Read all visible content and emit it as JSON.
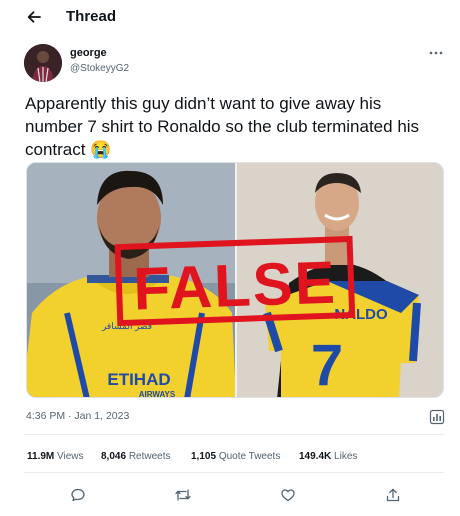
{
  "header": {
    "title": "Thread"
  },
  "author": {
    "name": "george",
    "handle": "@StokeyyG2"
  },
  "tweet": {
    "text": "Apparently this guy didn’t want to give away his number 7 shirt to Ronaldo so the club terminated his contract",
    "emoji": "😭",
    "timestamp": "4:36 PM · Jan 1, 2023"
  },
  "media": {
    "stamp_text": "FALSE",
    "left_jersey": {
      "sponsor": "ETIHAD",
      "sponsor_sub": "AIRWAYS",
      "top_text": "قصر المسافر"
    },
    "right_jersey": {
      "name_text": "NALDO",
      "number": "7"
    }
  },
  "stats": {
    "views_count": "11.9M",
    "views_label": "Views",
    "retweets_count": "8,046",
    "retweets_label": "Retweets",
    "quotes_count": "1,105",
    "quotes_label": "Quote Tweets",
    "likes_count": "149.4K",
    "likes_label": "Likes"
  },
  "colors": {
    "text": "#0f1419",
    "secondary": "#536471",
    "stamp": "#e0141e",
    "jersey_yellow": "#f2d12e",
    "jersey_blue": "#1f4aa8"
  },
  "icons": [
    "back-arrow-icon",
    "more-icon",
    "analytics-icon",
    "reply-icon",
    "retweet-icon",
    "like-icon",
    "share-icon"
  ]
}
